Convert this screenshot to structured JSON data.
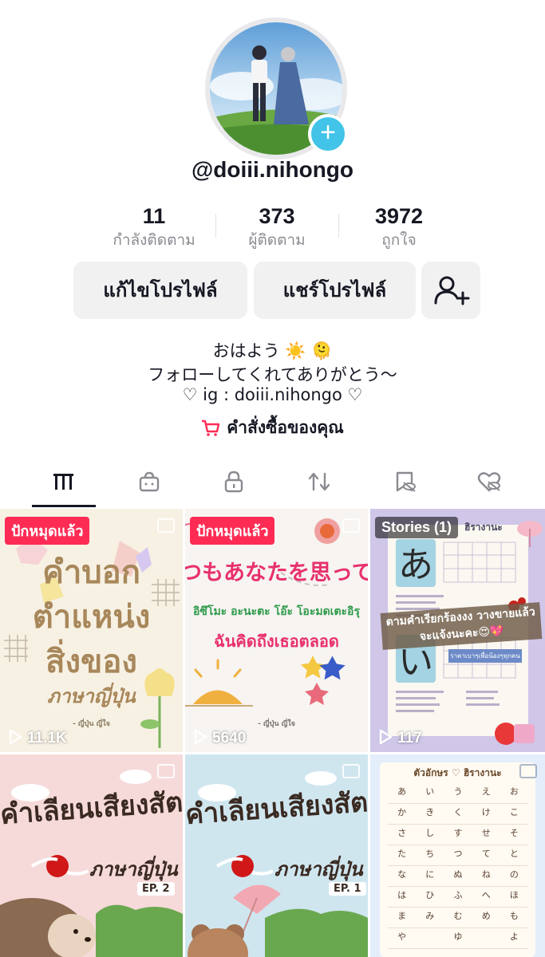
{
  "profile": {
    "username": "@doiii.nihongo",
    "add_badge": "+"
  },
  "stats": [
    {
      "value": "11",
      "label": "กำลังติดตาม"
    },
    {
      "value": "373",
      "label": "ผู้ติดตาม"
    },
    {
      "value": "3972",
      "label": "ถูกใจ"
    }
  ],
  "buttons": {
    "edit_profile": "แก้ไขโปรไฟล์",
    "share_profile": "แชร์โปรไฟล์"
  },
  "bio": {
    "line1": "おはよう ☀️ 🫠",
    "line2": "フォローしてくれてありがとう〜",
    "line3": "♡ ig : doiii.nihongo ♡"
  },
  "orders_label": "คำสั่งซื้อของคุณ",
  "tabs": [
    {
      "icon": "grid-icon",
      "active": true
    },
    {
      "icon": "shop-bag-icon"
    },
    {
      "icon": "lock-icon"
    },
    {
      "icon": "repost-icon"
    },
    {
      "icon": "bookmark-hidden-icon"
    },
    {
      "icon": "liked-hidden-icon"
    }
  ],
  "videos": [
    {
      "pinned_label": "ปักหมุดแล้ว",
      "title_lines": [
        "คำบอก",
        "ตำแหน่ง",
        "สิ่งของ"
      ],
      "subtitle": "ภาษาญี่ปุ่น",
      "credit": "- ญี่ปุ่น ญี่ใจ",
      "views": "11.1K",
      "bg": "#f7f1e4",
      "accent": "#a8875a"
    },
    {
      "pinned_label": "ปักหมุดแล้ว",
      "jp_text": "つもあなたを思ってい",
      "romaji": "อิซึโมะ อะนะตะ โอ๊ะ โอะมดเตะอิรุ",
      "thai_text": "ฉันคิดถึงเธอตลอด",
      "credit": "- ญี่ปุ่น ญี่ใจ",
      "views": "5640",
      "bg": "#f7f4f1",
      "accent": "#e8306d"
    },
    {
      "badge": "Stories (1)",
      "header": "ฮิรางานะ",
      "big_char_1": "あ",
      "big_char_2": "い",
      "note": "ตามคำเรียกร้องงง วางขายแล้วจะแจ้งนะคะ😍💖",
      "price_note": "ราคาเบาๆเพื่อน้องๆทุกคน",
      "views": "117",
      "bg": "#cfc6e8",
      "accent": "#6d5aa8"
    },
    {
      "title": "คำเลียนเสียงสัตว์",
      "subtitle": "ภาษาญี่ปุ่น",
      "episode": "EP. 2",
      "bg": "#f6dada",
      "accent": "#6b4a3a"
    },
    {
      "title": "คำเลียนเสียงสัตว์",
      "subtitle": "ภาษาญี่ปุ่น",
      "episode": "EP. 1",
      "bg": "#cfe6ef",
      "accent": "#6b4a3a"
    },
    {
      "title": "ตัวอักษร ♡ ฮิรางานะ",
      "kana_rows": [
        [
          "あ",
          "い",
          "う",
          "え",
          "お"
        ],
        [
          "か",
          "き",
          "く",
          "け",
          "こ"
        ],
        [
          "さ",
          "し",
          "す",
          "せ",
          "そ"
        ],
        [
          "た",
          "ち",
          "つ",
          "て",
          "と"
        ],
        [
          "な",
          "に",
          "ぬ",
          "ね",
          "の"
        ],
        [
          "は",
          "ひ",
          "ふ",
          "へ",
          "ほ"
        ],
        [
          "ま",
          "み",
          "む",
          "め",
          "も"
        ],
        [
          "や",
          "",
          "ゆ",
          "",
          "よ"
        ]
      ],
      "bg": "#e4eefa",
      "accent": "#6a4a2a"
    }
  ],
  "colors": {
    "pink": "#fe2c55",
    "teal": "#41c4e8",
    "gray_btn": "#f1f1f2",
    "muted": "#8a8b91"
  }
}
